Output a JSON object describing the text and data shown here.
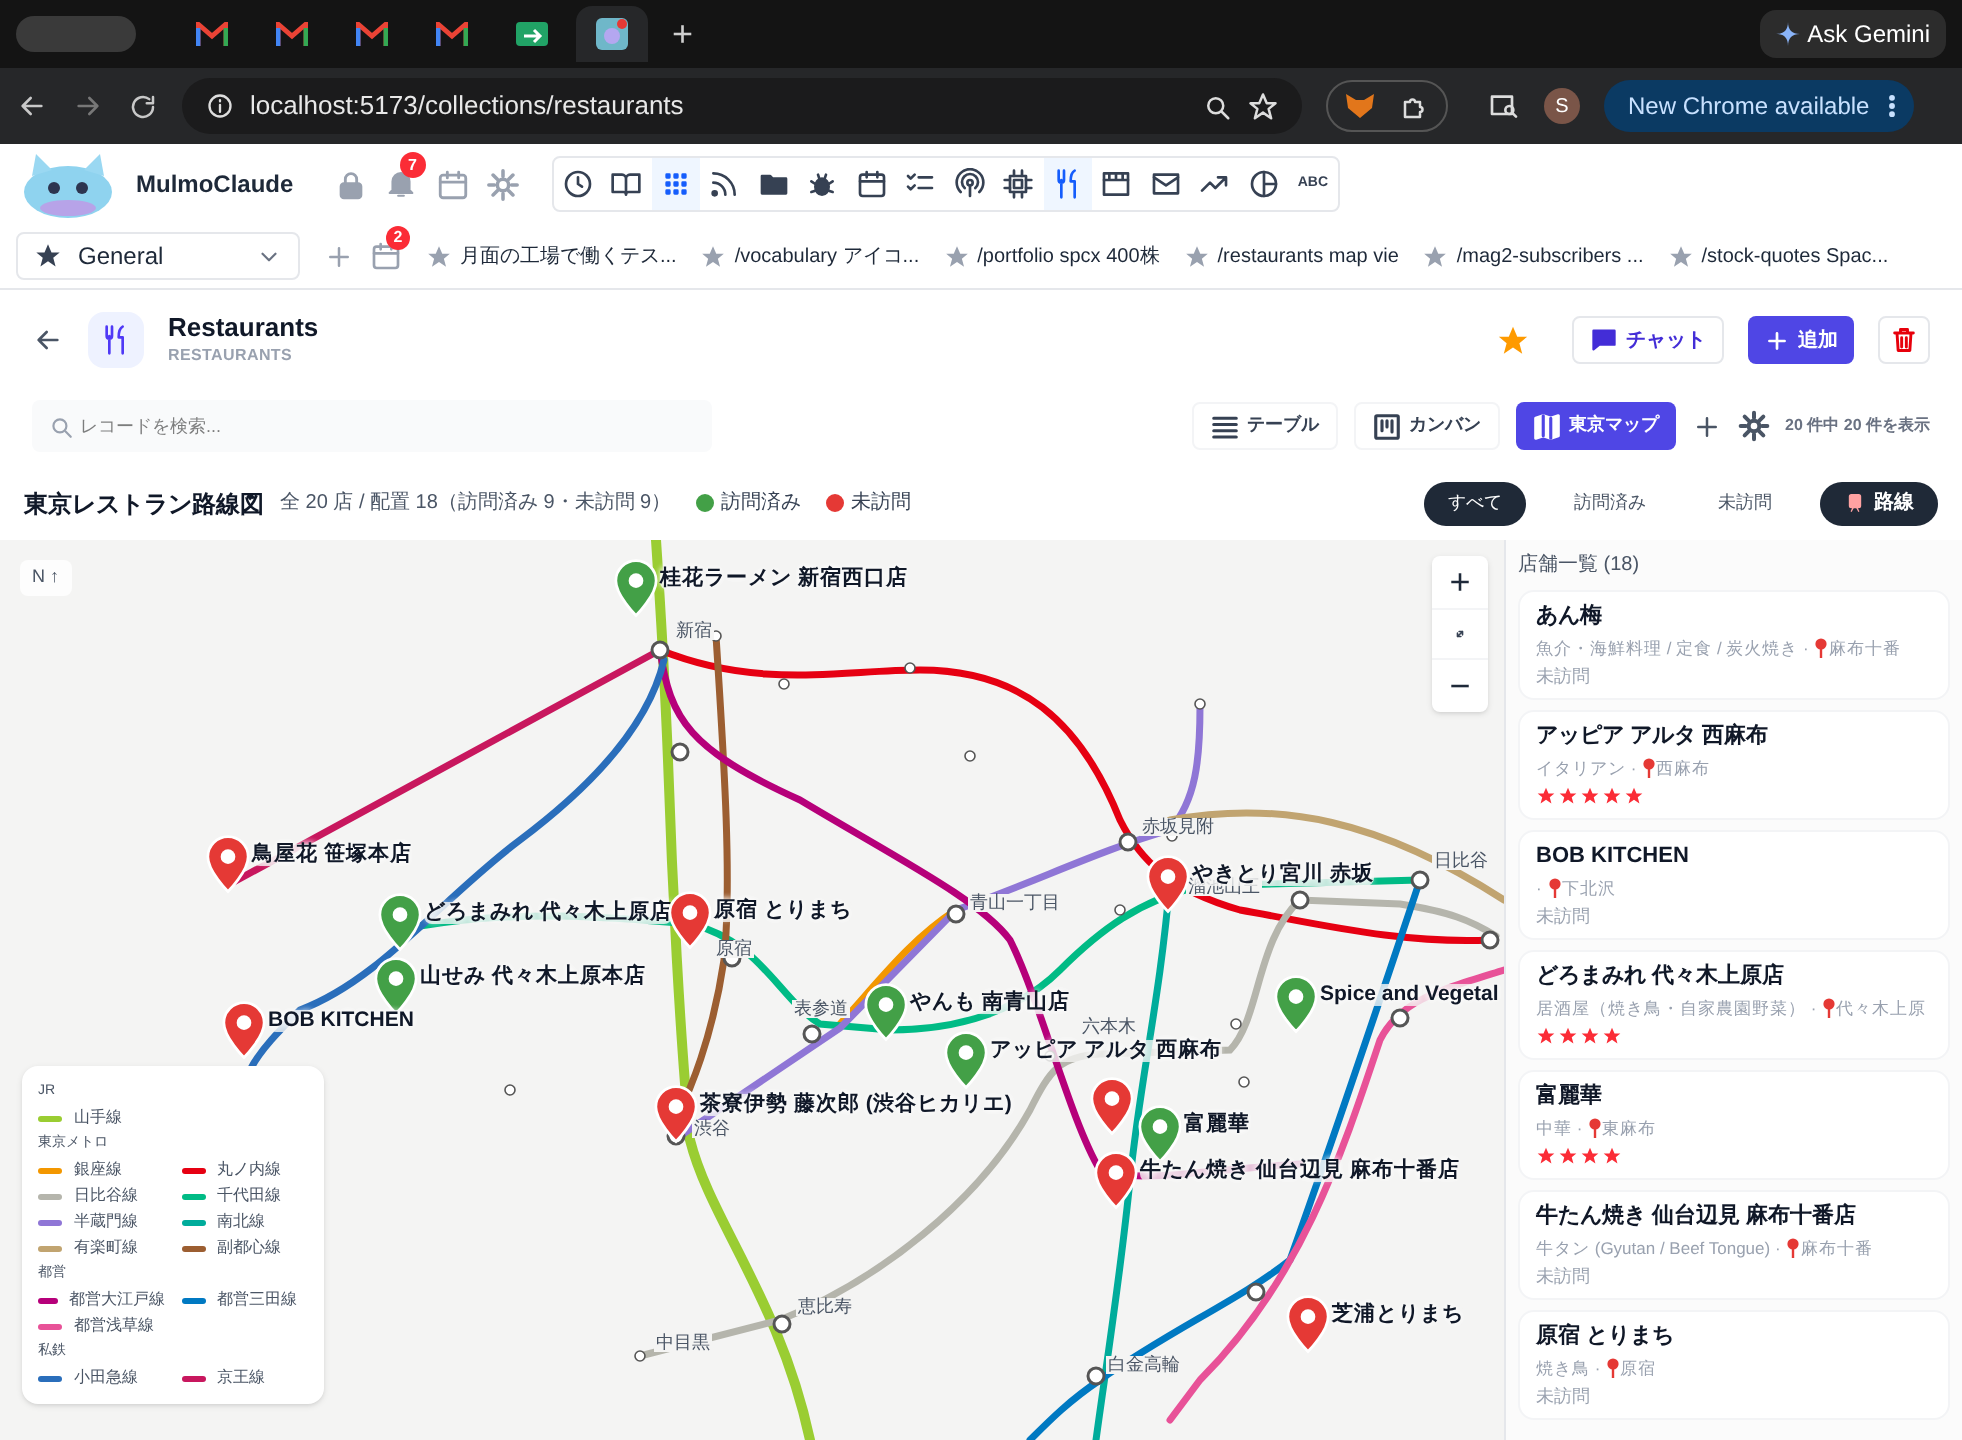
{
  "browser": {
    "tabs": [
      {
        "kind": "gmail",
        "selected": false
      },
      {
        "kind": "gmail",
        "selected": false
      },
      {
        "kind": "gmail",
        "selected": false
      },
      {
        "kind": "gmail",
        "selected": false
      },
      {
        "kind": "sheet",
        "selected": false
      },
      {
        "kind": "app",
        "selected": true
      }
    ],
    "new_tab": "+",
    "gemini": "Ask Gemini",
    "url": "localhost:5173/collections/restaurants",
    "profile": "S",
    "update": "New Chrome available"
  },
  "app_bar": {
    "brand": "MulmoClaude",
    "notifications": "7",
    "tools": [
      {
        "kind": "clock",
        "selected": false
      },
      {
        "kind": "book",
        "selected": false
      },
      {
        "kind": "grid",
        "selected": true
      },
      {
        "kind": "rss",
        "selected": false
      },
      {
        "kind": "folder",
        "selected": false
      },
      {
        "kind": "bug",
        "selected": false
      },
      {
        "kind": "calendar",
        "selected": false
      },
      {
        "kind": "checklist",
        "selected": false
      },
      {
        "kind": "podcast",
        "selected": false
      },
      {
        "kind": "chip",
        "selected": false
      },
      {
        "kind": "utensils",
        "selected": true
      },
      {
        "kind": "film",
        "selected": false
      },
      {
        "kind": "mail",
        "selected": false
      },
      {
        "kind": "trend",
        "selected": false
      },
      {
        "kind": "pie",
        "selected": false
      },
      {
        "kind": "text",
        "label": "ABC",
        "selected": false
      }
    ]
  },
  "bookmark_bar": {
    "workspace": "General",
    "badge": "2",
    "bookmarks": [
      "月面の工場で働くテス...",
      "/vocabulary アイコ...",
      "/portfolio spcx 400株",
      "/restaurants map vie",
      "/mag2-subscribers ...",
      "/stock-quotes Spac..."
    ]
  },
  "header": {
    "title": "Restaurants",
    "subtitle": "RESTAURANTS",
    "favorite": true,
    "chat": "チャット",
    "add": "追加"
  },
  "toolbar": {
    "search_placeholder": "レコードを検索...",
    "views": [
      {
        "kind": "table",
        "label": "テーブル",
        "selected": false
      },
      {
        "kind": "kanban",
        "label": "カンバン",
        "selected": false
      },
      {
        "kind": "map",
        "label": "東京マップ",
        "selected": true
      }
    ],
    "count": "20 件中 20 件を表示"
  },
  "map_header": {
    "title": "東京レストラン路線図",
    "summary": "全 20 店 / 配置 18（訪問済み 9・未訪問 9）",
    "legend": [
      {
        "label": "訪問済み",
        "color": "#43a047"
      },
      {
        "label": "未訪問",
        "color": "#e53935"
      }
    ],
    "filters": [
      {
        "label": "すべて",
        "selected": true
      },
      {
        "label": "訪問済み",
        "selected": false
      },
      {
        "label": "未訪問",
        "selected": false
      }
    ],
    "lines_toggle": {
      "label": "路線",
      "on": true
    }
  },
  "map": {
    "compass": "N ↑",
    "zoom_in": "+",
    "zoom_out": "−",
    "stations": [
      "新宿",
      "原宿",
      "表参道",
      "渋谷",
      "青山一丁目",
      "赤坂見附",
      "溜池山王",
      "日比谷",
      "六本木",
      "恵比寿",
      "中目黒",
      "白金高輪"
    ],
    "pins": [
      {
        "name": "桂花ラーメン 新宿西口店",
        "visited": true
      },
      {
        "name": "鳥屋花 笹塚本店",
        "visited": false
      },
      {
        "name": "どろまみれ 代々木上原店",
        "visited": true
      },
      {
        "name": "山せみ 代々木上原本店",
        "visited": true
      },
      {
        "name": "BOB KITCHEN",
        "visited": false
      },
      {
        "name": "原宿 とりまち",
        "visited": false
      },
      {
        "name": "茶寮伊勢 藤次郎 (渋谷ヒカリエ)",
        "visited": false
      },
      {
        "name": "やんも 南青山店",
        "visited": true
      },
      {
        "name": "アッピア アルタ 西麻布",
        "visited": true
      },
      {
        "name": "やきとり宮川 赤坂",
        "visited": false
      },
      {
        "name": "Spice and Vegetal",
        "visited": true
      },
      {
        "visited": false
      },
      {
        "name": "富麗華",
        "visited": true
      },
      {
        "name": "牛たん焼き 仙台辺見 麻布十番店",
        "visited": false
      },
      {
        "name": "芝浦とりまち",
        "visited": false
      }
    ]
  },
  "line_legend": {
    "groups": [
      {
        "name": "JR",
        "lines": [
          {
            "name": "山手線",
            "color": "#9acd32"
          }
        ]
      },
      {
        "name": "東京メトロ",
        "lines": [
          {
            "name": "銀座線",
            "color": "#f39700"
          },
          {
            "name": "丸ノ内線",
            "color": "#e60012"
          },
          {
            "name": "日比谷線",
            "color": "#b5b5ac"
          },
          {
            "name": "千代田線",
            "color": "#00bb85"
          },
          {
            "name": "半蔵門線",
            "color": "#8f76d6"
          },
          {
            "name": "南北線",
            "color": "#00ac9b"
          },
          {
            "name": "有楽町線",
            "color": "#c1a470"
          },
          {
            "name": "副都心線",
            "color": "#9c5e31"
          }
        ]
      },
      {
        "name": "都営",
        "lines": [
          {
            "name": "都営大江戸線",
            "color": "#b6007a"
          },
          {
            "name": "都営三田線",
            "color": "#0079c2"
          },
          {
            "name": "都営浅草線",
            "color": "#e85298"
          }
        ]
      },
      {
        "name": "私鉄",
        "lines": [
          {
            "name": "小田急線",
            "color": "#2a6ebb"
          },
          {
            "name": "京王線",
            "color": "#c8175e"
          }
        ]
      }
    ]
  },
  "sidebar": {
    "title": "店舗一覧 (18)",
    "items": [
      {
        "name": "あん梅",
        "category": "魚介・海鮮料理 / 定食 / 炭火焼き ·",
        "area": "麻布十番",
        "status": "未訪問"
      },
      {
        "name": "アッピア アルタ 西麻布",
        "category": "イタリアン ·",
        "area": "西麻布",
        "stars": 5
      },
      {
        "name": "BOB KITCHEN",
        "category": "·",
        "area": "下北沢",
        "status": "未訪問"
      },
      {
        "name": "どろまみれ 代々木上原店",
        "category": "居酒屋（焼き鳥・自家農園野菜） ·",
        "area": "代々木上原",
        "stars": 4
      },
      {
        "name": "富麗華",
        "category": "中華 ·",
        "area": "東麻布",
        "stars": 4
      },
      {
        "name": "牛たん焼き 仙台辺見 麻布十番店",
        "category": "牛タン (Gyutan / Beef Tongue) ·",
        "area": "麻布十番",
        "status": "未訪問"
      },
      {
        "name": "原宿 とりまち",
        "category": "焼き鳥 ·",
        "area": "原宿",
        "status": "未訪問"
      }
    ]
  }
}
